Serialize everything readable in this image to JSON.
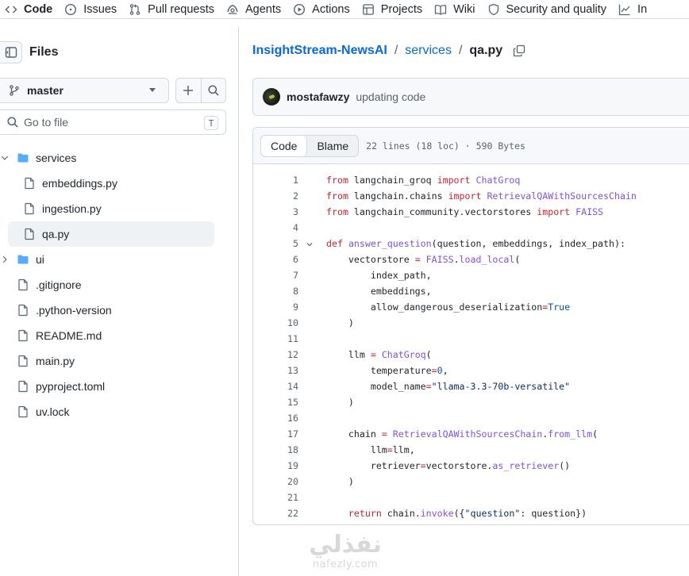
{
  "nav": {
    "tabs": [
      {
        "label": "Code",
        "icon": "code-icon",
        "active": true
      },
      {
        "label": "Issues",
        "icon": "issue-opened-icon"
      },
      {
        "label": "Pull requests",
        "icon": "git-pull-request-icon"
      },
      {
        "label": "Agents",
        "icon": "agents-icon"
      },
      {
        "label": "Actions",
        "icon": "play-icon"
      },
      {
        "label": "Projects",
        "icon": "table-icon"
      },
      {
        "label": "Wiki",
        "icon": "book-icon"
      },
      {
        "label": "Security and quality",
        "icon": "shield-icon"
      },
      {
        "label": "In",
        "icon": "graph-icon"
      }
    ]
  },
  "sidebar": {
    "title": "Files",
    "branch": "master",
    "goto_placeholder": "Go to file",
    "goto_shortcut": "T",
    "tree": [
      {
        "label": "services",
        "type": "folder",
        "expanded": true
      },
      {
        "label": "embeddings.py",
        "type": "file"
      },
      {
        "label": "ingestion.py",
        "type": "file"
      },
      {
        "label": "qa.py",
        "type": "file",
        "selected": true
      },
      {
        "label": "ui",
        "type": "folder",
        "expanded": false
      },
      {
        "label": ".gitignore",
        "type": "file"
      },
      {
        "label": ".python-version",
        "type": "file"
      },
      {
        "label": "README.md",
        "type": "file"
      },
      {
        "label": "main.py",
        "type": "file"
      },
      {
        "label": "pyproject.toml",
        "type": "file"
      },
      {
        "label": "uv.lock",
        "type": "file"
      }
    ]
  },
  "breadcrumb": {
    "repo": "InsightStream-NewsAI",
    "folder": "services",
    "file": "qa.py",
    "separator": "/"
  },
  "commit": {
    "author": "mostafawzy",
    "message": "updating code"
  },
  "code": {
    "view_tabs": [
      "Code",
      "Blame"
    ],
    "file_info": "22 lines (18 loc) · 590 Bytes",
    "lines": [
      [
        [
          "k",
          "from"
        ],
        [
          "t",
          " langchain_groq "
        ],
        [
          "k",
          "import"
        ],
        [
          "t",
          " "
        ],
        [
          "f",
          "ChatGroq"
        ]
      ],
      [
        [
          "k",
          "from"
        ],
        [
          "t",
          " langchain.chains "
        ],
        [
          "k",
          "import"
        ],
        [
          "t",
          " "
        ],
        [
          "f",
          "RetrievalQAWithSourcesChain"
        ]
      ],
      [
        [
          "k",
          "from"
        ],
        [
          "t",
          " langchain_community.vectorstores "
        ],
        [
          "k",
          "import"
        ],
        [
          "t",
          " "
        ],
        [
          "f",
          "FAISS"
        ]
      ],
      [],
      [
        [
          "k",
          "def"
        ],
        [
          "t",
          " "
        ],
        [
          "f",
          "answer_question"
        ],
        [
          "t",
          "(question, embeddings, index_path):"
        ]
      ],
      [
        [
          "t",
          "    vectorstore "
        ],
        [
          "k",
          "="
        ],
        [
          "t",
          " "
        ],
        [
          "f",
          "FAISS"
        ],
        [
          "t",
          "."
        ],
        [
          "f",
          "load_local"
        ],
        [
          "t",
          "("
        ]
      ],
      [
        [
          "t",
          "        index_path,"
        ]
      ],
      [
        [
          "t",
          "        embeddings,"
        ]
      ],
      [
        [
          "t",
          "        allow_dangerous_deserialization"
        ],
        [
          "k",
          "="
        ],
        [
          "c",
          "True"
        ]
      ],
      [
        [
          "t",
          "    )"
        ]
      ],
      [],
      [
        [
          "t",
          "    llm "
        ],
        [
          "k",
          "="
        ],
        [
          "t",
          " "
        ],
        [
          "f",
          "ChatGroq"
        ],
        [
          "t",
          "("
        ]
      ],
      [
        [
          "t",
          "        temperature"
        ],
        [
          "k",
          "="
        ],
        [
          "c",
          "0"
        ],
        [
          "t",
          ","
        ]
      ],
      [
        [
          "t",
          "        model_name"
        ],
        [
          "k",
          "="
        ],
        [
          "s",
          "\"llama-3.3-70b-versatile\""
        ]
      ],
      [
        [
          "t",
          "    )"
        ]
      ],
      [],
      [
        [
          "t",
          "    chain "
        ],
        [
          "k",
          "="
        ],
        [
          "t",
          " "
        ],
        [
          "f",
          "RetrievalQAWithSourcesChain"
        ],
        [
          "t",
          "."
        ],
        [
          "f",
          "from_llm"
        ],
        [
          "t",
          "("
        ]
      ],
      [
        [
          "t",
          "        llm"
        ],
        [
          "k",
          "="
        ],
        [
          "t",
          "llm,"
        ]
      ],
      [
        [
          "t",
          "        retriever"
        ],
        [
          "k",
          "="
        ],
        [
          "t",
          "vectorstore."
        ],
        [
          "f",
          "as_retriever"
        ],
        [
          "t",
          "()"
        ]
      ],
      [
        [
          "t",
          "    )"
        ]
      ],
      [],
      [
        [
          "t",
          "    "
        ],
        [
          "k",
          "return"
        ],
        [
          "t",
          " chain."
        ],
        [
          "f",
          "invoke"
        ],
        [
          "t",
          "({"
        ],
        [
          "s",
          "\"question\""
        ],
        [
          "t",
          ": question})"
        ]
      ]
    ],
    "colors": {
      "k": "#cf222e",
      "f": "#8250df",
      "s": "#0a3069",
      "c": "#0550ae",
      "t": "#1f2328"
    }
  },
  "watermark": {
    "arabic": "نفذلي",
    "latin": "nafezly.com"
  }
}
